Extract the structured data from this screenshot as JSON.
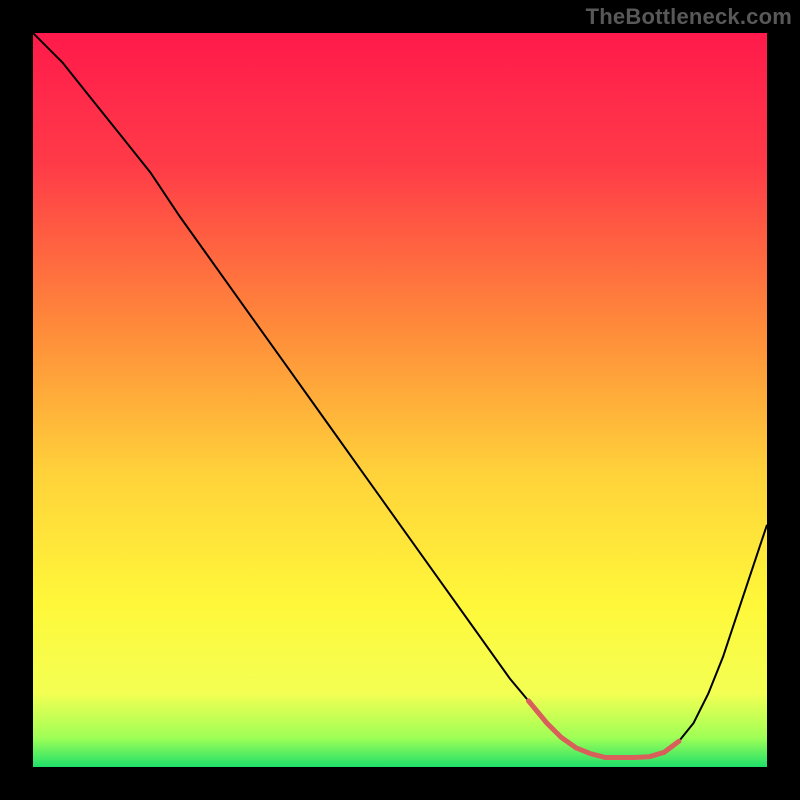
{
  "watermark": "TheBottleneck.com",
  "chart_data": {
    "type": "line",
    "title": "",
    "xlabel": "",
    "ylabel": "",
    "xlim": [
      0,
      100
    ],
    "ylim": [
      0,
      100
    ],
    "grid": false,
    "annotations": [],
    "series": [
      {
        "name": "bottleneck-curve",
        "stroke": "#000000",
        "x": [
          0,
          4,
          8,
          12,
          16,
          20,
          25,
          30,
          35,
          40,
          45,
          50,
          55,
          60,
          65,
          67.5,
          70,
          72,
          74,
          76,
          78,
          80,
          82,
          84,
          86,
          88,
          90,
          92,
          94,
          96,
          98,
          100
        ],
        "values": [
          100,
          96,
          91,
          86,
          81,
          75,
          68,
          61,
          54,
          47,
          40,
          33,
          26,
          19,
          12,
          9,
          6,
          4,
          2.6,
          1.8,
          1.3,
          1.3,
          1.3,
          1.4,
          2.0,
          3.5,
          6,
          10,
          15,
          21,
          27,
          33
        ]
      },
      {
        "name": "highlight-trough",
        "stroke": "#d9605a",
        "stroke_width": 5,
        "x": [
          67.5,
          70,
          72,
          74,
          76,
          78,
          80,
          82,
          84,
          86,
          88
        ],
        "values": [
          9,
          6,
          4,
          2.6,
          1.8,
          1.3,
          1.3,
          1.3,
          1.4,
          2.0,
          3.5
        ]
      }
    ],
    "background_gradient": {
      "stops": [
        {
          "offset": 0.0,
          "color": "#ff1a4b"
        },
        {
          "offset": 0.18,
          "color": "#ff3b48"
        },
        {
          "offset": 0.4,
          "color": "#ff8a3a"
        },
        {
          "offset": 0.6,
          "color": "#ffd23a"
        },
        {
          "offset": 0.78,
          "color": "#fff83a"
        },
        {
          "offset": 0.9,
          "color": "#f3ff53"
        },
        {
          "offset": 0.96,
          "color": "#9fff56"
        },
        {
          "offset": 1.0,
          "color": "#1fe06a"
        }
      ]
    }
  }
}
